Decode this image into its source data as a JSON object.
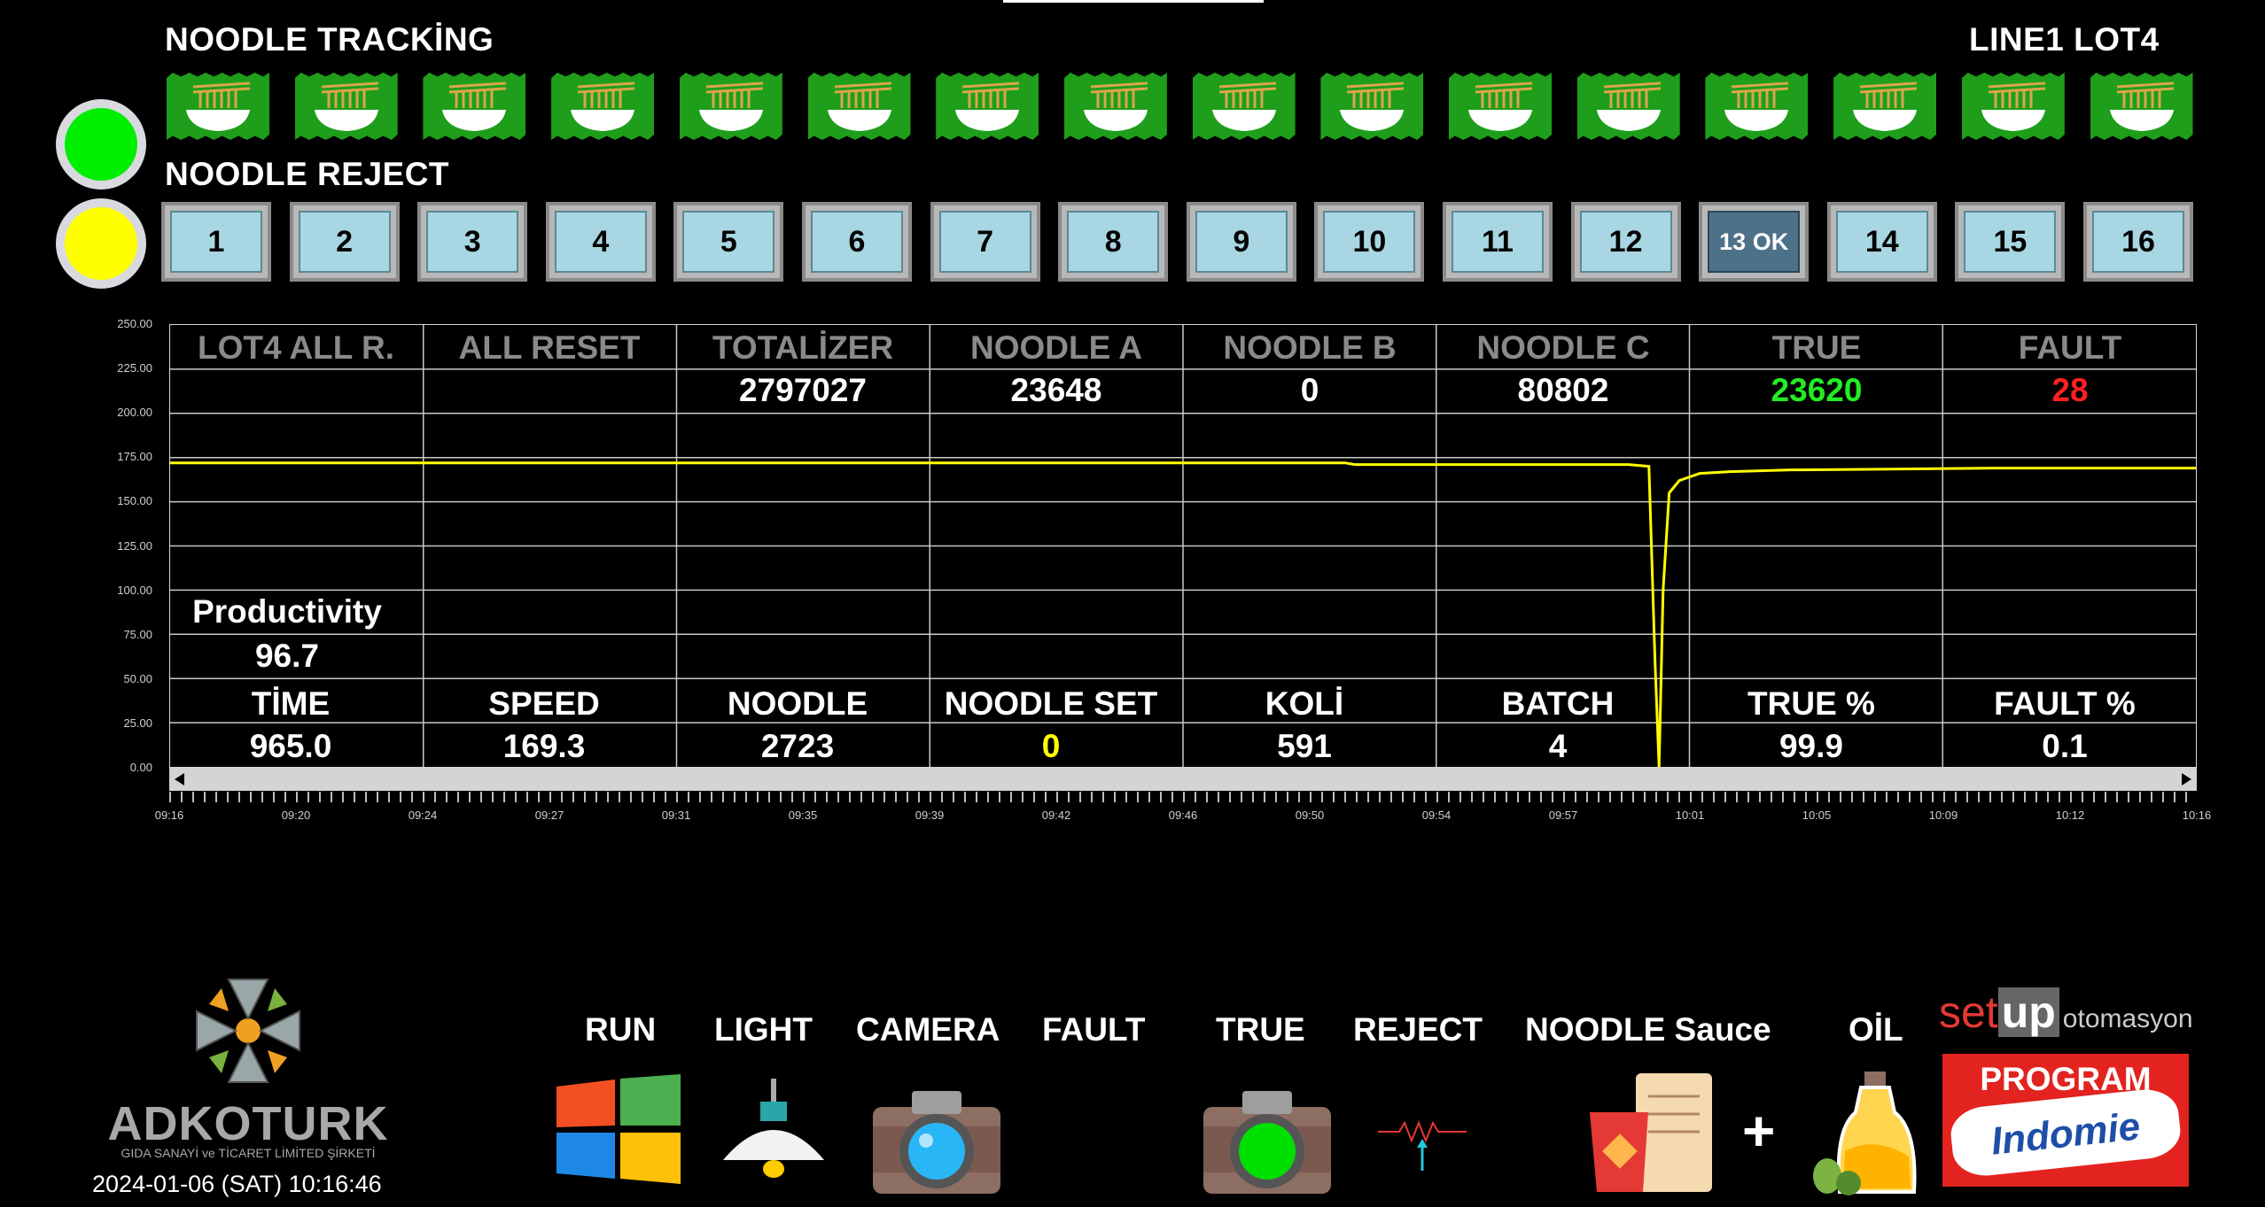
{
  "header": {
    "tracking_title": "NOODLE TRACKİNG",
    "reject_title": "NOODLE REJECT",
    "line_lot": "LINE1 LOT4"
  },
  "lamps": {
    "run": {
      "color": "#00ff00"
    },
    "warning": {
      "color": "#ffff00"
    }
  },
  "tracking_icons": {
    "count": 16,
    "icon": "noodle-bowl-icon",
    "color": "#1e9e1a"
  },
  "reject_buttons": [
    "1",
    "2",
    "3",
    "4",
    "5",
    "6",
    "7",
    "8",
    "9",
    "10",
    "11",
    "12",
    "13 OK",
    "14",
    "15",
    "16"
  ],
  "table": {
    "headers": [
      "LOT4 ALL R.",
      "ALL RESET",
      "TOTALİZER",
      "NOODLE A",
      "NOODLE B",
      "NOODLE C",
      "TRUE",
      "FAULT"
    ],
    "values": [
      "",
      "",
      "2797027",
      "23648",
      "0",
      "80802",
      "23620",
      "28"
    ],
    "value_colors": [
      "#ffffff",
      "#ffffff",
      "#ffffff",
      "#ffffff",
      "#ffffff",
      "#ffffff",
      "#22ee22",
      "#ff2020"
    ],
    "productivity_label": "Productivity",
    "productivity_value": "96.7",
    "metric_labels": [
      "TİME",
      "SPEED",
      "NOODLE",
      "NOODLE SET",
      "KOLİ",
      "BATCH",
      "TRUE %",
      "FAULT %"
    ],
    "metric_values": [
      "965.0",
      "169.3",
      "2723",
      "0",
      "591",
      "4",
      "99.9",
      "0.1"
    ],
    "metric_value_colors": [
      "#ffffff",
      "#ffffff",
      "#ffffff",
      "#ffff00",
      "#ffffff",
      "#ffffff",
      "#ffffff",
      "#ffffff"
    ]
  },
  "chart_data": {
    "type": "line",
    "ylim": [
      0,
      250
    ],
    "yticks": [
      "250.00",
      "225.00",
      "200.00",
      "175.00",
      "150.00",
      "125.00",
      "100.00",
      "75.00",
      "50.00",
      "25.00",
      "0.00"
    ],
    "xticks": [
      "09:16",
      "09:20",
      "09:24",
      "09:27",
      "09:31",
      "09:35",
      "09:39",
      "09:42",
      "09:46",
      "09:50",
      "09:54",
      "09:57",
      "10:01",
      "10:05",
      "10:09",
      "10:12",
      "10:16"
    ],
    "series": [
      {
        "color": "#ffff00",
        "points": [
          [
            0,
            172
          ],
          [
            0.3,
            172
          ],
          [
            0.58,
            172
          ],
          [
            0.585,
            171
          ],
          [
            0.6,
            171
          ],
          [
            0.72,
            171
          ],
          [
            0.73,
            170
          ],
          [
            0.733,
            60
          ],
          [
            0.735,
            0
          ],
          [
            0.737,
            100
          ],
          [
            0.74,
            155
          ],
          [
            0.745,
            162
          ],
          [
            0.755,
            166
          ],
          [
            0.77,
            167
          ],
          [
            0.8,
            168
          ],
          [
            0.9,
            169
          ],
          [
            1.0,
            169
          ]
        ]
      }
    ]
  },
  "bottom": {
    "labels": [
      "RUN",
      "LIGHT",
      "CAMERA",
      "FAULT",
      "TRUE",
      "REJECT",
      "NOODLE Sauce",
      "OİL"
    ],
    "company": "ADKOTURK",
    "company_sub": "GIDA SANAYİ ve TİCARET LİMİTED ŞİRKETİ",
    "datetime": "2024-01-06 (SAT) 10:16:46",
    "setup_logo_1": "set",
    "setup_logo_2": "up",
    "setup_logo_3": "otomasyon",
    "program_label": "PROGRAM",
    "brand": "Indomie"
  }
}
